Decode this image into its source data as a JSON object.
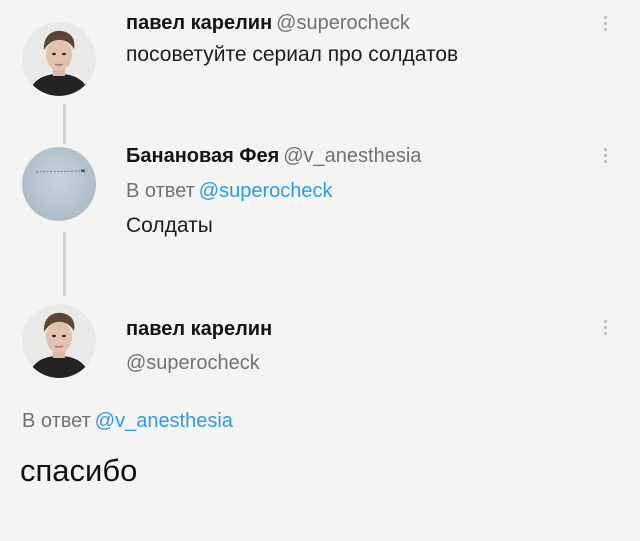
{
  "tweet1": {
    "name": "павел карелин",
    "handle": "@superocheck",
    "text": "посоветуйте сериал про солдатов"
  },
  "tweet2": {
    "name": "Банановая Фея",
    "handle": "@v_anesthesia",
    "reply_prefix": "В ответ",
    "reply_to": "@superocheck",
    "text": "Солдаты"
  },
  "tweet3": {
    "name": "павел карелин",
    "handle": "@superocheck",
    "reply_prefix": "В ответ",
    "reply_to": "@v_anesthesia",
    "text": "спасибо"
  },
  "icons": {
    "menu": "kebab-menu-icon"
  }
}
